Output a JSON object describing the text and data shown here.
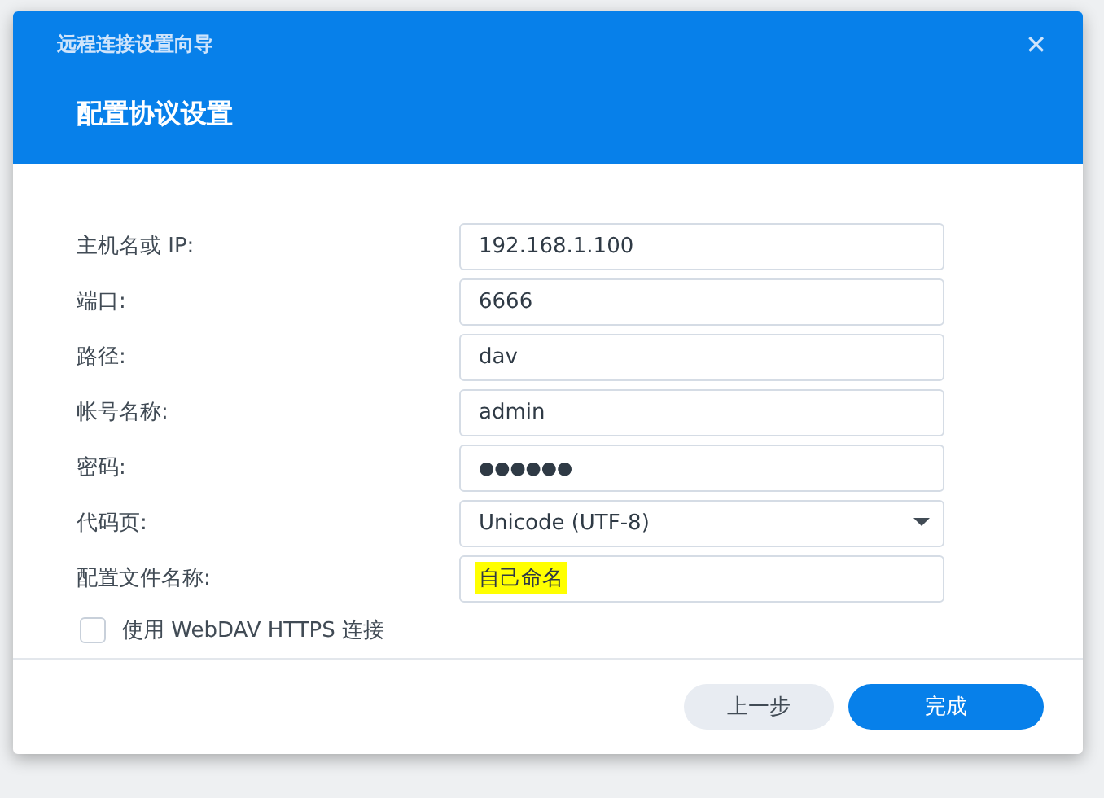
{
  "window": {
    "title": "远程连接设置向导",
    "close": "✕"
  },
  "header": {
    "heading": "配置协议设置"
  },
  "fields": [
    {
      "label": "主机名或 IP:",
      "kind": "text",
      "value": "192.168.1.100",
      "highlighted": false
    },
    {
      "label": "端口:",
      "kind": "text",
      "value": "6666",
      "highlighted": false
    },
    {
      "label": "路径:",
      "kind": "text",
      "value": "dav",
      "highlighted": false
    },
    {
      "label": "帐号名称:",
      "kind": "text",
      "value": "admin",
      "highlighted": false
    },
    {
      "label": "密码:",
      "kind": "password",
      "value": "●●●●●●",
      "highlighted": false
    },
    {
      "label": "代码页:",
      "kind": "select",
      "value": "Unicode (UTF-8)",
      "highlighted": false
    },
    {
      "label": "配置文件名称:",
      "kind": "text",
      "value": "自己命名",
      "highlighted": true
    }
  ],
  "checkbox": {
    "label": "使用 WebDAV HTTPS 连接",
    "checked": false
  },
  "buttons": [
    {
      "label": "上一步",
      "kind": "secondary"
    },
    {
      "label": "完成",
      "kind": "primary"
    }
  ]
}
